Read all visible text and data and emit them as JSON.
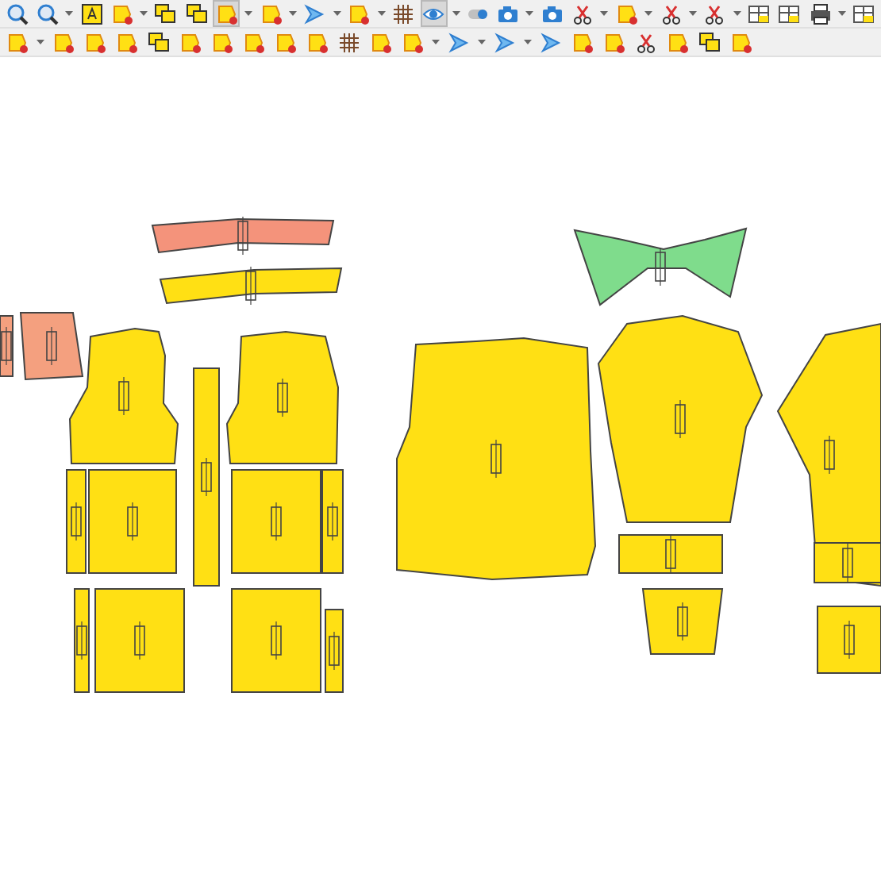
{
  "toolbars": [
    {
      "buttons": [
        {
          "kind": "zoom",
          "selected": false,
          "dropdown": false
        },
        {
          "kind": "zoom",
          "selected": false,
          "dropdown": true
        },
        {
          "kind": "text",
          "selected": false,
          "dropdown": false
        },
        {
          "kind": "piece",
          "selected": false,
          "dropdown": true
        },
        {
          "kind": "layers",
          "selected": false,
          "dropdown": false
        },
        {
          "kind": "layers",
          "selected": false,
          "dropdown": false
        },
        {
          "kind": "piece",
          "selected": true,
          "dropdown": true
        },
        {
          "kind": "piece",
          "selected": false,
          "dropdown": true
        },
        {
          "kind": "arrow",
          "selected": false,
          "dropdown": true
        },
        {
          "kind": "piece",
          "selected": false,
          "dropdown": true
        },
        {
          "kind": "grid",
          "selected": false,
          "dropdown": false
        },
        {
          "kind": "eye",
          "selected": true,
          "dropdown": true
        },
        {
          "kind": "toggle",
          "selected": false,
          "dropdown": false
        },
        {
          "kind": "camera",
          "selected": false,
          "dropdown": true
        },
        {
          "kind": "camera",
          "selected": false,
          "dropdown": false
        },
        {
          "kind": "scissors",
          "selected": false,
          "dropdown": true
        },
        {
          "kind": "piece",
          "selected": false,
          "dropdown": true
        },
        {
          "kind": "scissors",
          "selected": false,
          "dropdown": true
        },
        {
          "kind": "scissors",
          "selected": false,
          "dropdown": true
        },
        {
          "kind": "table",
          "selected": false,
          "dropdown": false
        },
        {
          "kind": "table",
          "selected": false,
          "dropdown": false
        },
        {
          "kind": "printer",
          "selected": false,
          "dropdown": true
        },
        {
          "kind": "table",
          "selected": false,
          "dropdown": false
        }
      ]
    },
    {
      "buttons": [
        {
          "kind": "piece",
          "selected": false,
          "dropdown": true
        },
        {
          "kind": "piece",
          "selected": false,
          "dropdown": false
        },
        {
          "kind": "piece",
          "selected": false,
          "dropdown": false
        },
        {
          "kind": "piece",
          "selected": false,
          "dropdown": false
        },
        {
          "kind": "layers",
          "selected": false,
          "dropdown": false
        },
        {
          "kind": "piece",
          "selected": false,
          "dropdown": false
        },
        {
          "kind": "piece",
          "selected": false,
          "dropdown": false
        },
        {
          "kind": "piece",
          "selected": false,
          "dropdown": false
        },
        {
          "kind": "piece",
          "selected": false,
          "dropdown": false
        },
        {
          "kind": "piece",
          "selected": false,
          "dropdown": false
        },
        {
          "kind": "grid",
          "selected": false,
          "dropdown": false
        },
        {
          "kind": "piece",
          "selected": false,
          "dropdown": false
        },
        {
          "kind": "piece",
          "selected": false,
          "dropdown": true
        },
        {
          "kind": "arrow",
          "selected": false,
          "dropdown": true
        },
        {
          "kind": "arrow",
          "selected": false,
          "dropdown": true
        },
        {
          "kind": "arrow",
          "selected": false,
          "dropdown": false
        },
        {
          "kind": "piece",
          "selected": false,
          "dropdown": false
        },
        {
          "kind": "piece",
          "selected": false,
          "dropdown": false
        },
        {
          "kind": "scissors",
          "selected": false,
          "dropdown": false
        },
        {
          "kind": "piece",
          "selected": false,
          "dropdown": false
        },
        {
          "kind": "layers",
          "selected": false,
          "dropdown": false
        },
        {
          "kind": "piece",
          "selected": false,
          "dropdown": false
        }
      ]
    }
  ],
  "pieces": [
    {
      "color": "#f4937b"
    },
    {
      "color": "#ffe014"
    },
    {
      "color": "#7fdc8c"
    },
    {
      "color": "#f4a07f"
    },
    {
      "color": "#f4a07f"
    },
    {
      "color": "#ffe014"
    },
    {
      "color": "#ffe014"
    },
    {
      "color": "#ffe014"
    },
    {
      "color": "#ffe014"
    },
    {
      "color": "#ffe014"
    },
    {
      "color": "#ffe014"
    },
    {
      "color": "#ffe014"
    },
    {
      "color": "#ffe014"
    },
    {
      "color": "#ffe014"
    },
    {
      "color": "#ffe014"
    },
    {
      "color": "#ffe014"
    },
    {
      "color": "#ffe014"
    },
    {
      "color": "#ffe014"
    },
    {
      "color": "#ffe014"
    },
    {
      "color": "#ffe014"
    },
    {
      "color": "#ffe014"
    },
    {
      "color": "#ffe014"
    },
    {
      "color": "#ffe014"
    }
  ]
}
